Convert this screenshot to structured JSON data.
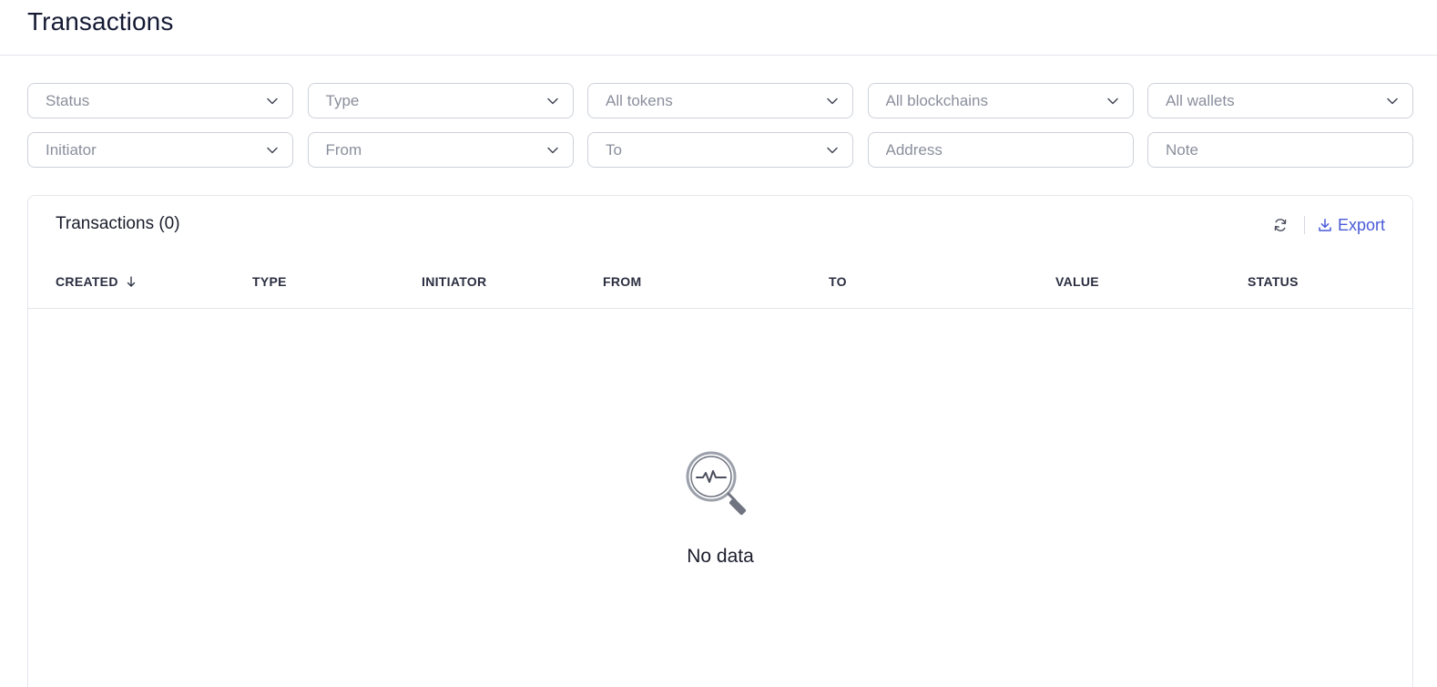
{
  "page": {
    "title": "Transactions"
  },
  "filters": {
    "status": "Status",
    "type": "Type",
    "tokens": "All tokens",
    "blockchains": "All blockchains",
    "wallets": "All wallets",
    "initiator": "Initiator",
    "from": "From",
    "to": "To",
    "address_placeholder": "Address",
    "note_placeholder": "Note"
  },
  "table": {
    "title": "Transactions (0)",
    "export_label": "Export",
    "columns": [
      "CREATED",
      "TYPE",
      "INITIATOR",
      "FROM",
      "TO",
      "VALUE",
      "STATUS"
    ],
    "sort_column": "CREATED",
    "sort_direction": "desc",
    "rows": [],
    "empty_text": "No data"
  },
  "icons": {
    "dropdown": "chevron-down-icon",
    "refresh": "refresh-icon",
    "export": "download-icon",
    "sort": "arrow-down-icon",
    "empty": "magnifier-pulse-icon"
  },
  "colors": {
    "accent": "#4a5bd8",
    "title": "#141a33",
    "placeholder": "#8a8f9c",
    "border": "#cdd1d8"
  }
}
